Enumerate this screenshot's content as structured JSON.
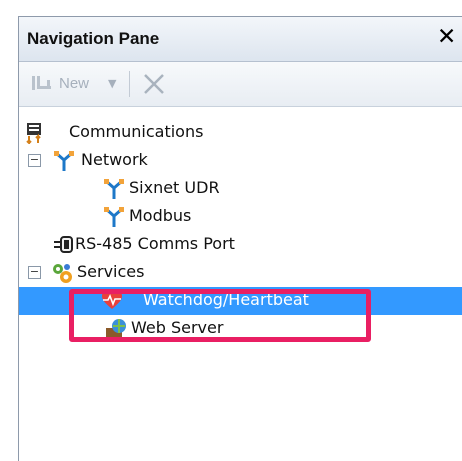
{
  "pane": {
    "title": "Navigation Pane"
  },
  "toolbar": {
    "new_label": "New"
  },
  "tree": [
    {
      "label": "Communications"
    },
    {
      "label": "Network",
      "expanded": true
    },
    {
      "label": "Sixnet UDR"
    },
    {
      "label": "Modbus"
    },
    {
      "label": "RS-485 Comms Port"
    },
    {
      "label": "Services",
      "expanded": true
    },
    {
      "label": "Watchdog/Heartbeat",
      "selected": true
    },
    {
      "label": "Web Server"
    }
  ],
  "colors": {
    "selection": "#3399ff",
    "highlight": "#e91f63"
  }
}
